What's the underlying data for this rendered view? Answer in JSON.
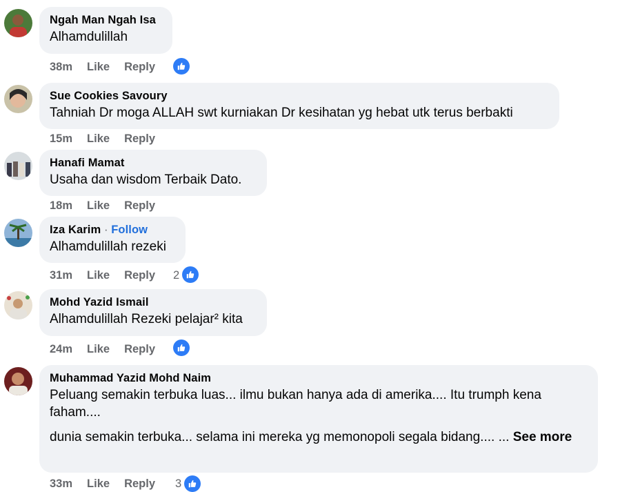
{
  "comments": [
    {
      "author": "Ngah Man Ngah Isa",
      "text": "Alhamdulillah",
      "time": "38m",
      "like": "Like",
      "reply": "Reply"
    },
    {
      "author": "Sue Cookies Savoury",
      "text": "Tahniah Dr moga ALLAH swt kurniakan Dr kesihatan yg hebat utk terus berbakti",
      "time": "15m",
      "like": "Like",
      "reply": "Reply"
    },
    {
      "author": "Hanafi Mamat",
      "text": "Usaha dan wisdom Terbaik Dato.",
      "time": "18m",
      "like": "Like",
      "reply": "Reply"
    },
    {
      "author": "Iza Karim",
      "separator": "·",
      "follow": "Follow",
      "text": "Alhamdulillah rezeki",
      "time": "31m",
      "like": "Like",
      "reply": "Reply",
      "reactions": "2"
    },
    {
      "author": "Mohd Yazid Ismail",
      "text": "Alhamdulillah Rezeki pelajar² kita",
      "time": "24m",
      "like": "Like",
      "reply": "Reply"
    },
    {
      "author": "Muhammad Yazid Mohd Naim",
      "text": "Peluang semakin terbuka luas... ilmu bukan hanya ada di amerika.... Itu trumph kena faham....",
      "text2": "dunia semakin terbuka... selama ini mereka yg memonopoli segala bidang.... ...",
      "see_more": "See more",
      "time": "33m",
      "like": "Like",
      "reply": "Reply",
      "reactions": "3"
    }
  ],
  "colors": {
    "bubble": "#f0f2f5",
    "meta": "#65676b",
    "link": "#216fdb",
    "like_badge": "#2d7cf6"
  },
  "icons": {
    "reaction": "thumbs-up-icon"
  }
}
